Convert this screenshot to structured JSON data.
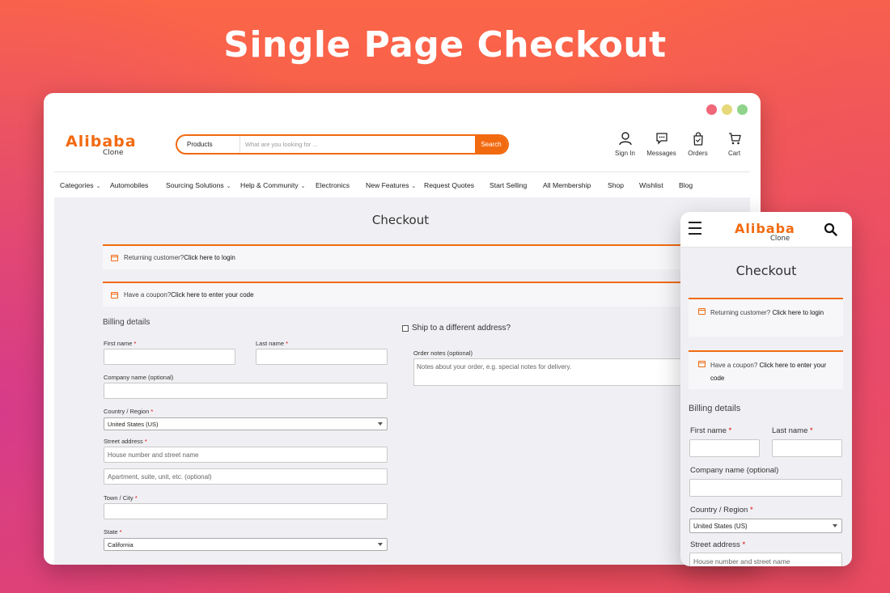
{
  "headline": "Single Page Checkout",
  "colors": {
    "accent": "#f26a10",
    "dot_red": "#f06778",
    "dot_yellow": "#e6d97a",
    "dot_green": "#8fd48a"
  },
  "desktop": {
    "logo": {
      "brand": "Alibaba",
      "sub": "Clone"
    },
    "search": {
      "category": "Products",
      "placeholder": "What are you looking for ...",
      "button": "Search"
    },
    "top_icons": [
      {
        "icon": "user-icon",
        "label": "Sign In"
      },
      {
        "icon": "chat-icon",
        "label": "Messages"
      },
      {
        "icon": "bag-icon",
        "label": "Orders"
      },
      {
        "icon": "cart-icon",
        "label": "Cart"
      }
    ],
    "nav": [
      {
        "label": "Categories",
        "dropdown": true
      },
      {
        "label": "Automobiles",
        "dropdown": false
      },
      {
        "label": "Sourcing Solutions",
        "dropdown": true
      },
      {
        "label": "Help & Community",
        "dropdown": true
      },
      {
        "label": "Electronics",
        "dropdown": false
      },
      {
        "label": "New Features",
        "dropdown": true
      },
      {
        "label": "Request Quotes",
        "dropdown": false
      },
      {
        "label": "Start Selling",
        "dropdown": false
      },
      {
        "label": "All Membership",
        "dropdown": false
      },
      {
        "label": "Shop",
        "dropdown": false
      },
      {
        "label": "Wishlist",
        "dropdown": false
      },
      {
        "label": "Blog",
        "dropdown": false
      }
    ],
    "page_title": "Checkout",
    "notice_returning": {
      "text": "Returning customer? ",
      "link": "Click here to login"
    },
    "notice_coupon": {
      "text": "Have a coupon? ",
      "link": "Click here to enter your code"
    },
    "billing_title": "Billing details",
    "first_name_label": "First name",
    "last_name_label": "Last name",
    "company_label": "Company name (optional)",
    "country_label": "Country / Region",
    "country_value": "United States (US)",
    "street_label": "Street address",
    "street_placeholder": "House number and street name",
    "apartment_placeholder": "Apartment, suite, unit, etc. (optional)",
    "town_label": "Town / City",
    "state_label": "State",
    "state_value": "California",
    "required_mark": "*",
    "ship_label": "Ship to a different address?",
    "order_notes_label": "Order notes (optional)",
    "order_notes_placeholder": "Notes about your order, e.g. special notes for delivery."
  },
  "mobile": {
    "logo": {
      "brand": "Alibaba",
      "sub": "Clone"
    },
    "page_title": "Checkout",
    "notice_returning": {
      "text": "Returning customer? ",
      "link": "Click here to login"
    },
    "notice_coupon": {
      "text": "Have a coupon? ",
      "link": "Click here to enter your code"
    },
    "billing_title": "Billing details",
    "first_name_label": "First name",
    "last_name_label": "Last name",
    "company_label": "Company name (optional)",
    "country_label": "Country / Region",
    "country_value": "United States (US)",
    "street_label": "Street address",
    "street_placeholder": "House number and street name"
  }
}
